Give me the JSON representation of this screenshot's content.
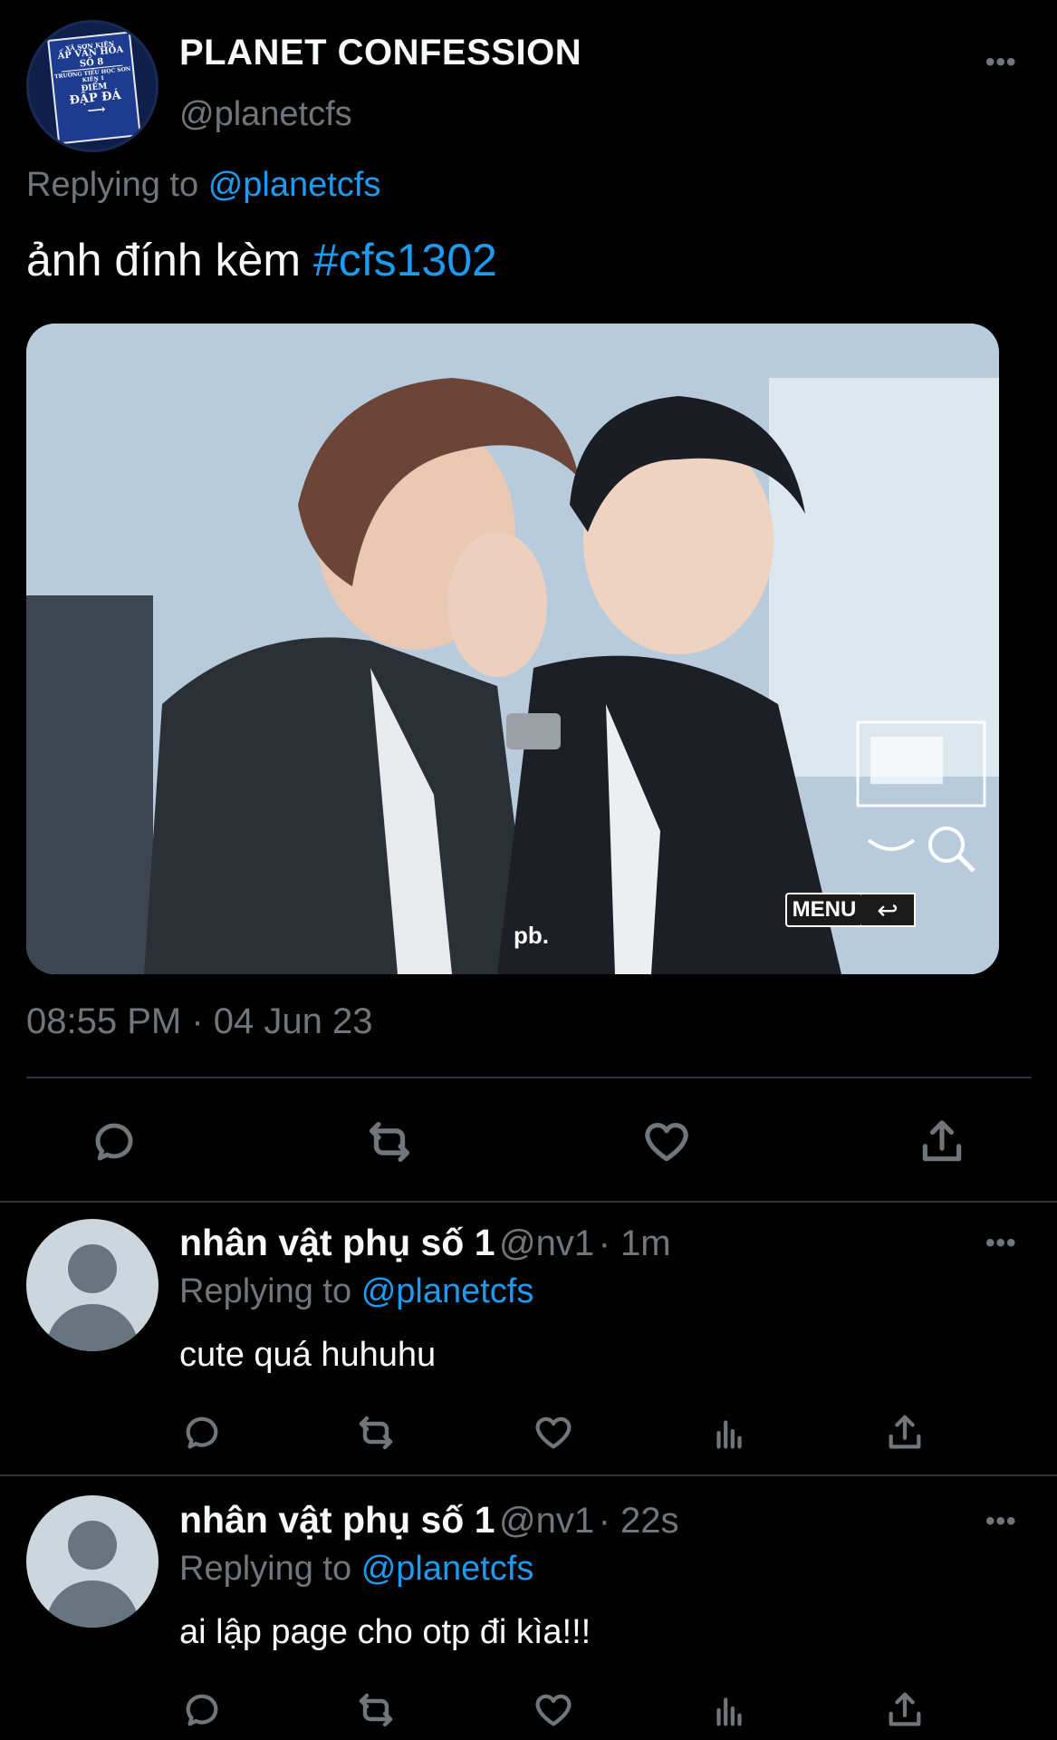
{
  "tweet": {
    "avatar_sign": {
      "line1": "XÃ SƠN KIÊN",
      "line2": "ẤP VĂN HÓA",
      "line3": "SỐ 8",
      "line4": "TRƯỜNG TIỂU HỌC SƠN KIÊN 1",
      "line5": "ĐIỂM",
      "line6": "ĐẬP ĐÁ"
    },
    "display_name": "PLANET CONFESSION",
    "handle": "@planetcfs",
    "more_label": "•••",
    "replying_prefix": "Replying to",
    "replying_to": "@planetcfs",
    "text": "ảnh đính kèm",
    "hashtag": "#cfs1302",
    "media_overlay": {
      "menu_label": "MENU",
      "watermark": "pb."
    },
    "timestamp": "08:55 PM · 04 Jun 23"
  },
  "actions_main": [
    "reply-icon",
    "retweet-icon",
    "like-icon",
    "share-icon"
  ],
  "replies": [
    {
      "name": "nhân vật phụ số 1",
      "handle": "@nv1",
      "time": "· 1m",
      "replying_prefix": "Replying to",
      "replying_to": "@planetcfs",
      "text": "cute quá huhuhu",
      "more_label": "•••"
    },
    {
      "name": "nhân vật phụ số 1",
      "handle": "@nv1",
      "time": "· 22s",
      "replying_prefix": "Replying to",
      "replying_to": "@planetcfs",
      "text": "ai lập page cho otp đi kìa!!!",
      "more_label": "•••"
    }
  ],
  "colors": {
    "background": "#000000",
    "text": "#f7f9f9",
    "muted": "#71767b",
    "link": "#1d9bf0",
    "divider": "#2f3336"
  }
}
